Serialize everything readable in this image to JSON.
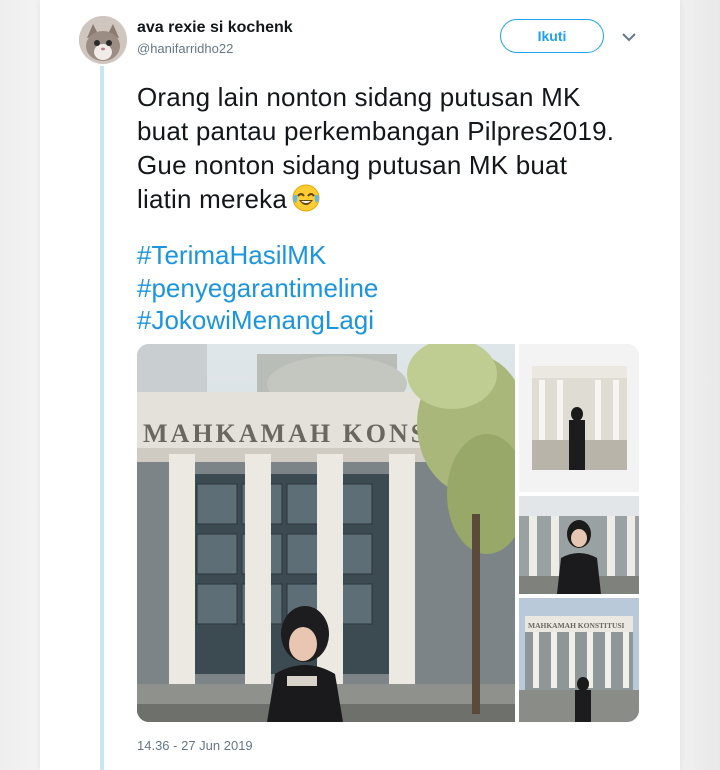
{
  "tweet": {
    "display_name": "ava rexie si kochenk",
    "handle": "@hanifarridho22",
    "follow_label": "Ikuti",
    "text_lines": [
      "Orang lain nonton sidang putusan MK",
      "buat pantau perkembangan Pilpres2019.",
      "Gue nonton sidang putusan MK buat",
      "liatin mereka"
    ],
    "emoji": "face-with-tears-of-joy-icon",
    "hashtags": [
      "#TerimaHasilMK",
      "#penyegarantimeline",
      "#JokowiMenangLagi"
    ],
    "media": {
      "building_sign": "MAHKAMAH KONSTI",
      "thumb_sign": "MAHKAMAH KONSTITUSI"
    },
    "timestamp": "14.36 - 27 Jun 2019"
  },
  "colors": {
    "accent": "#1da1f2",
    "hashtag": "#1b95e0",
    "thread_line": "#c9e6f7",
    "text": "#14171a",
    "muted": "#657786"
  }
}
